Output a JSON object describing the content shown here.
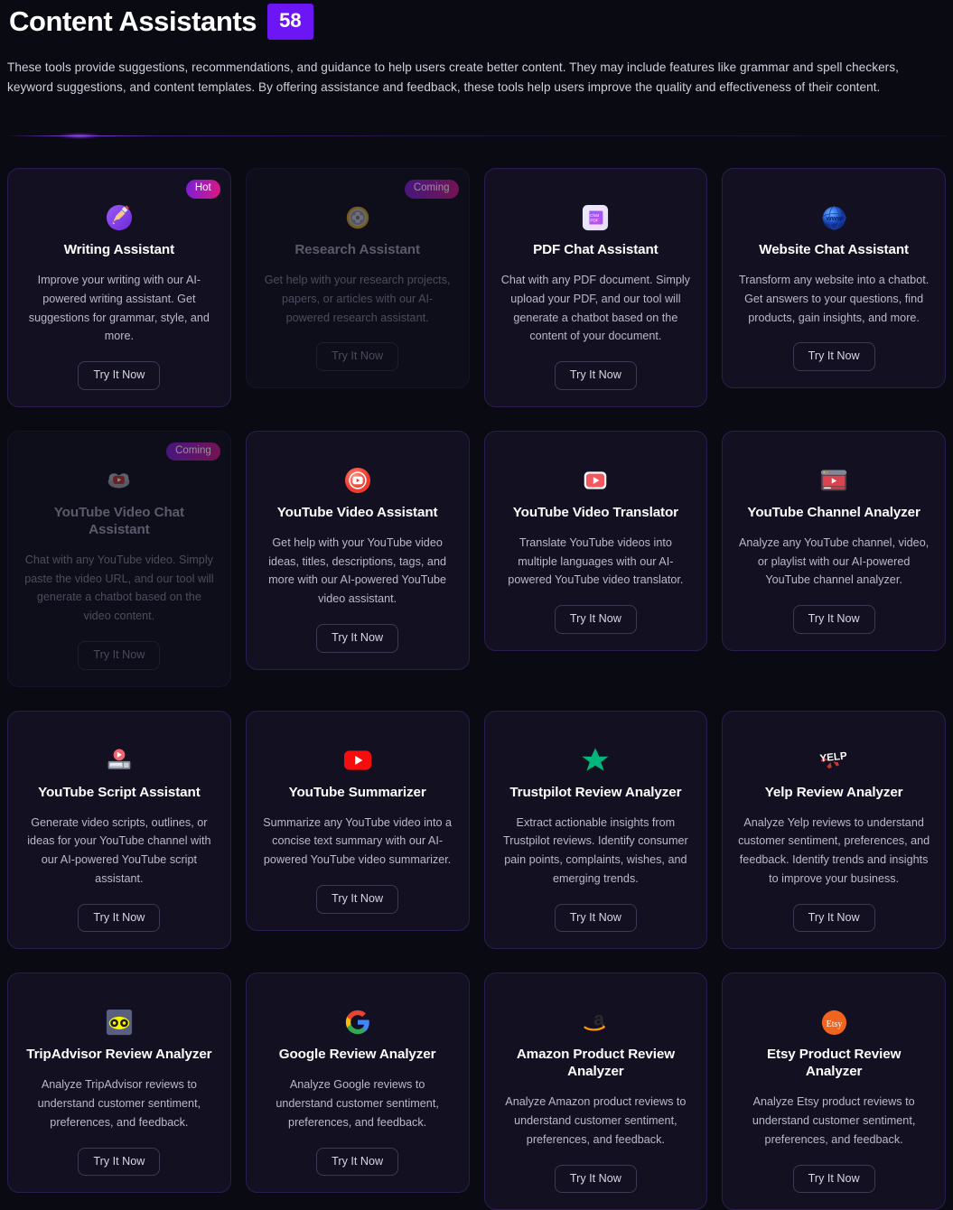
{
  "header": {
    "title": "Content Assistants",
    "count": "58",
    "count_color": "#6d16f5",
    "description": "These tools provide suggestions, recommendations, and guidance to help users create better content. They may include features like grammar and spell checkers, keyword suggestions, and content templates. By offering assistance and feedback, these tools help users improve the quality and effectiveness of their content."
  },
  "labels": {
    "try_it_now": "Try It Now",
    "badge_hot": "Hot",
    "badge_coming": "Coming"
  },
  "cards": [
    {
      "title": "Writing Assistant",
      "description": "Improve your writing with our AI-powered writing assistant. Get suggestions for grammar, style, and more.",
      "badge": "Hot",
      "badge_type": "hot",
      "icon": "writing-hand-icon",
      "button": "Try It Now",
      "coming": false
    },
    {
      "title": "Research Assistant",
      "description": "Get help with your research projects, papers, or articles with our AI-powered research assistant.",
      "badge": "Coming",
      "badge_type": "coming",
      "icon": "research-medal-icon",
      "button": "Try It Now",
      "coming": true
    },
    {
      "title": "PDF Chat Assistant",
      "description": "Chat with any PDF document. Simply upload your PDF, and our tool will generate a chatbot based on the content of your document.",
      "badge": "",
      "badge_type": "",
      "icon": "chatpdf-icon",
      "button": "Try It Now",
      "coming": false
    },
    {
      "title": "Website Chat Assistant",
      "description": "Transform any website into a chatbot. Get answers to your questions, find products, gain insights, and more.",
      "badge": "",
      "badge_type": "",
      "icon": "www-globe-icon",
      "button": "Try It Now",
      "coming": false
    },
    {
      "title": "YouTube Video Chat Assistant",
      "description": "Chat with any YouTube video. Simply paste the video URL, and our tool will generate a chatbot based on the video content.",
      "badge": "Coming",
      "badge_type": "coming",
      "icon": "youtube-cloud-icon",
      "button": "Try It Now",
      "coming": true
    },
    {
      "title": "YouTube Video Assistant",
      "description": "Get help with your YouTube video ideas, titles, descriptions, tags, and more with our AI-powered YouTube video assistant.",
      "badge": "",
      "badge_type": "",
      "icon": "youtube-circle-icon",
      "button": "Try It Now",
      "coming": false
    },
    {
      "title": "YouTube Video Translator",
      "description": "Translate YouTube videos into multiple languages with our AI-powered YouTube video translator.",
      "badge": "",
      "badge_type": "",
      "icon": "youtube-play-icon",
      "button": "Try It Now",
      "coming": false
    },
    {
      "title": "YouTube Channel Analyzer",
      "description": "Analyze any YouTube channel, video, or playlist with our AI-powered YouTube channel analyzer.",
      "badge": "",
      "badge_type": "",
      "icon": "video-window-icon",
      "button": "Try It Now",
      "coming": false
    },
    {
      "title": "YouTube Script Assistant",
      "description": "Generate video scripts, outlines, or ideas for your YouTube channel with our AI-powered YouTube script assistant.",
      "badge": "",
      "badge_type": "",
      "icon": "script-player-icon",
      "button": "Try It Now",
      "coming": false
    },
    {
      "title": "YouTube Summarizer",
      "description": "Summarize any YouTube video into a concise text summary with our AI-powered YouTube video summarizer.",
      "badge": "",
      "badge_type": "",
      "icon": "youtube-logo-icon",
      "button": "Try It Now",
      "coming": false
    },
    {
      "title": "Trustpilot Review Analyzer",
      "description": "Extract actionable insights from Trustpilot reviews. Identify consumer pain points, complaints, wishes, and emerging trends.",
      "badge": "",
      "badge_type": "",
      "icon": "trustpilot-star-icon",
      "button": "Try It Now",
      "coming": false
    },
    {
      "title": "Yelp Review Analyzer",
      "description": "Analyze Yelp reviews to understand customer sentiment, preferences, and feedback. Identify trends and insights to improve your business.",
      "badge": "",
      "badge_type": "",
      "icon": "yelp-logo-icon",
      "button": "Try It Now",
      "coming": false
    },
    {
      "title": "TripAdvisor Review Analyzer",
      "description": "Analyze TripAdvisor reviews to understand customer sentiment, preferences, and feedback.",
      "badge": "",
      "badge_type": "",
      "icon": "tripadvisor-owl-icon",
      "button": "Try It Now",
      "coming": false
    },
    {
      "title": "Google Review Analyzer",
      "description": "Analyze Google reviews to understand customer sentiment, preferences, and feedback.",
      "badge": "",
      "badge_type": "",
      "icon": "google-g-icon",
      "button": "Try It Now",
      "coming": false
    },
    {
      "title": "Amazon Product Review Analyzer",
      "description": "Analyze Amazon product reviews to understand customer sentiment, preferences, and feedback.",
      "badge": "",
      "badge_type": "",
      "icon": "amazon-logo-icon",
      "button": "Try It Now",
      "coming": false
    },
    {
      "title": "Etsy Product Review Analyzer",
      "description": "Analyze Etsy product reviews to understand customer sentiment, preferences, and feedback.",
      "badge": "",
      "badge_type": "",
      "icon": "etsy-logo-icon",
      "button": "Try It Now",
      "coming": false
    }
  ]
}
